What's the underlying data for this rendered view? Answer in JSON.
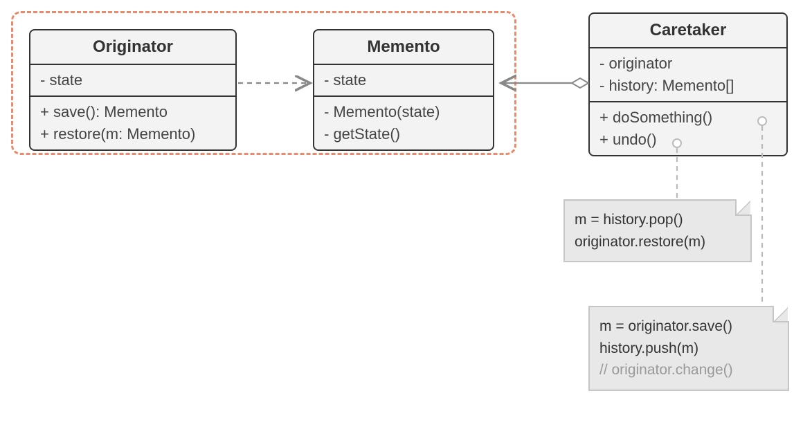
{
  "classes": {
    "originator": {
      "title": "Originator",
      "fields": [
        "- state"
      ],
      "methods": [
        "+ save(): Memento",
        "+ restore(m: Memento)"
      ]
    },
    "memento": {
      "title": "Memento",
      "fields": [
        "- state"
      ],
      "methods": [
        "- Memento(state)",
        "- getState()"
      ]
    },
    "caretaker": {
      "title": "Caretaker",
      "fields": [
        "- originator",
        "- history: Memento[]"
      ],
      "methods": [
        "+ doSomething()",
        "+ undo()"
      ]
    }
  },
  "notes": {
    "undo": {
      "lines": [
        "m = history.pop()",
        "originator.restore(m)"
      ]
    },
    "doSomething": {
      "lines": [
        "m = originator.save()",
        "history.push(m)"
      ],
      "comment": "// originator.change()"
    }
  },
  "colors": {
    "dashedBorder": "#e88a6b",
    "boxBorder": "#333333",
    "boxFill": "#f3f3f3",
    "noteFill": "#e8e8e8",
    "noteBorder": "#c5c5c5",
    "connectorGray": "#bbbbbb"
  }
}
